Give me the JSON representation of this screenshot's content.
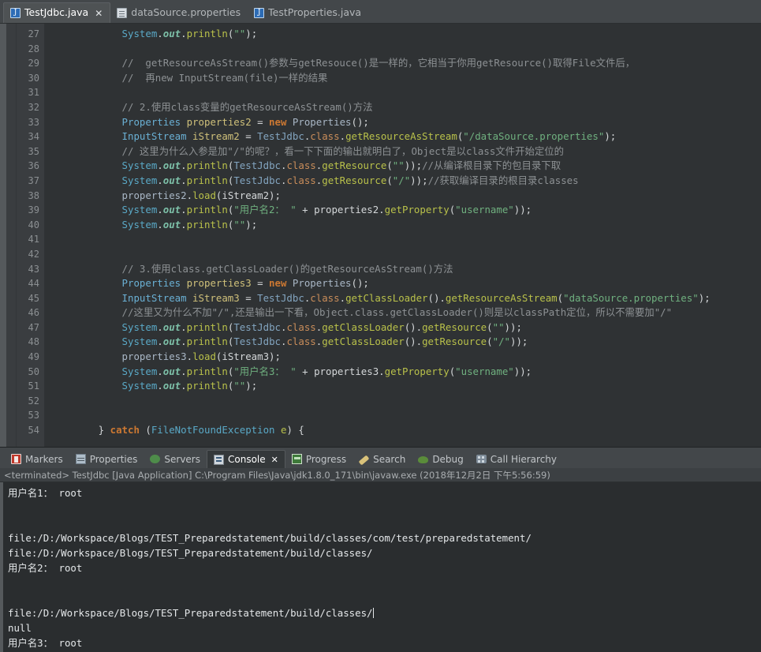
{
  "editor_tabs": [
    {
      "label": "TestJdbc.java",
      "icon": "java-file-icon",
      "active": true,
      "close": "✕"
    },
    {
      "label": "dataSource.properties",
      "icon": "properties-file-icon",
      "active": false,
      "close": ""
    },
    {
      "label": "TestProperties.java",
      "icon": "java-file-icon",
      "active": false,
      "close": ""
    }
  ],
  "gutter": {
    "first_line": 27,
    "numbers": [
      27,
      28,
      29,
      30,
      31,
      32,
      33,
      34,
      35,
      36,
      37,
      38,
      39,
      40,
      41,
      42,
      43,
      44,
      45,
      46,
      47,
      48,
      49,
      50,
      51,
      52,
      53,
      54
    ]
  },
  "code_lines": [
    {
      "n": 27,
      "segments": [
        {
          "t": "            ",
          "c": "pln"
        },
        {
          "t": "System",
          "c": "sys"
        },
        {
          "t": ".",
          "c": "pln"
        },
        {
          "t": "out",
          "c": "out"
        },
        {
          "t": ".",
          "c": "pln"
        },
        {
          "t": "println",
          "c": "mth"
        },
        {
          "t": "(",
          "c": "pln"
        },
        {
          "t": "\"\"",
          "c": "str"
        },
        {
          "t": ");",
          "c": "pln"
        }
      ]
    },
    {
      "n": 28,
      "segments": [
        {
          "t": "",
          "c": "pln"
        }
      ]
    },
    {
      "n": 29,
      "segments": [
        {
          "t": "            ",
          "c": "pln"
        },
        {
          "t": "//  getResourceAsStream()参数与getResouce()是一样的，它相当于你用getResource()取得File文件后，",
          "c": "cmt"
        }
      ]
    },
    {
      "n": 30,
      "segments": [
        {
          "t": "            ",
          "c": "pln"
        },
        {
          "t": "//  再new InputStream(file)一样的结果",
          "c": "cmt"
        }
      ]
    },
    {
      "n": 31,
      "segments": [
        {
          "t": "",
          "c": "pln"
        }
      ]
    },
    {
      "n": 32,
      "segments": [
        {
          "t": "            ",
          "c": "pln"
        },
        {
          "t": "// 2.使用class变量的getResourceAsStream()方法",
          "c": "cmt"
        }
      ]
    },
    {
      "n": 33,
      "segments": [
        {
          "t": "            ",
          "c": "pln"
        },
        {
          "t": "Properties",
          "c": "type"
        },
        {
          "t": " properties2 ",
          "c": "var"
        },
        {
          "t": "= ",
          "c": "pln"
        },
        {
          "t": "new",
          "c": "kw"
        },
        {
          "t": " ",
          "c": "pln"
        },
        {
          "t": "Properties",
          "c": "pvar"
        },
        {
          "t": "();",
          "c": "pln"
        }
      ]
    },
    {
      "n": 34,
      "segments": [
        {
          "t": "            ",
          "c": "pln"
        },
        {
          "t": "InputStream",
          "c": "type"
        },
        {
          "t": " iStream2 ",
          "c": "var"
        },
        {
          "t": "= ",
          "c": "pln"
        },
        {
          "t": "TestJdbc",
          "c": "cls"
        },
        {
          "t": ".",
          "c": "pln"
        },
        {
          "t": "class",
          "c": "cfld"
        },
        {
          "t": ".",
          "c": "pln"
        },
        {
          "t": "getResourceAsStream",
          "c": "mth"
        },
        {
          "t": "(",
          "c": "pln"
        },
        {
          "t": "\"/dataSource.properties\"",
          "c": "str"
        },
        {
          "t": ");",
          "c": "pln"
        }
      ]
    },
    {
      "n": 35,
      "segments": [
        {
          "t": "            ",
          "c": "pln"
        },
        {
          "t": "// 这里为什么入参是加\"/\"的呢？，看一下下面的输出就明白了，Object是以class文件开始定位的",
          "c": "cmt"
        }
      ]
    },
    {
      "n": 36,
      "segments": [
        {
          "t": "            ",
          "c": "pln"
        },
        {
          "t": "System",
          "c": "sys"
        },
        {
          "t": ".",
          "c": "pln"
        },
        {
          "t": "out",
          "c": "out"
        },
        {
          "t": ".",
          "c": "pln"
        },
        {
          "t": "println",
          "c": "mth"
        },
        {
          "t": "(",
          "c": "pln"
        },
        {
          "t": "TestJdbc",
          "c": "cls"
        },
        {
          "t": ".",
          "c": "pln"
        },
        {
          "t": "class",
          "c": "cfld"
        },
        {
          "t": ".",
          "c": "pln"
        },
        {
          "t": "getResource",
          "c": "mth"
        },
        {
          "t": "(",
          "c": "pln"
        },
        {
          "t": "\"\"",
          "c": "str"
        },
        {
          "t": "));",
          "c": "pln"
        },
        {
          "t": "//从编译根目录下的包目录下取",
          "c": "cmt"
        }
      ]
    },
    {
      "n": 37,
      "segments": [
        {
          "t": "            ",
          "c": "pln"
        },
        {
          "t": "System",
          "c": "sys"
        },
        {
          "t": ".",
          "c": "pln"
        },
        {
          "t": "out",
          "c": "out"
        },
        {
          "t": ".",
          "c": "pln"
        },
        {
          "t": "println",
          "c": "mth"
        },
        {
          "t": "(",
          "c": "pln"
        },
        {
          "t": "TestJdbc",
          "c": "cls"
        },
        {
          "t": ".",
          "c": "pln"
        },
        {
          "t": "class",
          "c": "cfld"
        },
        {
          "t": ".",
          "c": "pln"
        },
        {
          "t": "getResource",
          "c": "mth"
        },
        {
          "t": "(",
          "c": "pln"
        },
        {
          "t": "\"/\"",
          "c": "str"
        },
        {
          "t": "));",
          "c": "pln"
        },
        {
          "t": "//获取编译目录的根目录classes",
          "c": "cmt"
        }
      ]
    },
    {
      "n": 38,
      "segments": [
        {
          "t": "            ",
          "c": "pln"
        },
        {
          "t": "properties2",
          "c": "pvar"
        },
        {
          "t": ".",
          "c": "pln"
        },
        {
          "t": "load",
          "c": "mth"
        },
        {
          "t": "(iStream2);",
          "c": "pln"
        }
      ]
    },
    {
      "n": 39,
      "segments": [
        {
          "t": "            ",
          "c": "pln"
        },
        {
          "t": "System",
          "c": "sys"
        },
        {
          "t": ".",
          "c": "pln"
        },
        {
          "t": "out",
          "c": "out"
        },
        {
          "t": ".",
          "c": "pln"
        },
        {
          "t": "println",
          "c": "mth"
        },
        {
          "t": "(",
          "c": "pln"
        },
        {
          "t": "\"用户名2： \"",
          "c": "str"
        },
        {
          "t": " + properties2.",
          "c": "pln"
        },
        {
          "t": "getProperty",
          "c": "mth"
        },
        {
          "t": "(",
          "c": "pln"
        },
        {
          "t": "\"username\"",
          "c": "str"
        },
        {
          "t": "));",
          "c": "pln"
        }
      ]
    },
    {
      "n": 40,
      "segments": [
        {
          "t": "            ",
          "c": "pln"
        },
        {
          "t": "System",
          "c": "sys"
        },
        {
          "t": ".",
          "c": "pln"
        },
        {
          "t": "out",
          "c": "out"
        },
        {
          "t": ".",
          "c": "pln"
        },
        {
          "t": "println",
          "c": "mth"
        },
        {
          "t": "(",
          "c": "pln"
        },
        {
          "t": "\"\"",
          "c": "str"
        },
        {
          "t": ");",
          "c": "pln"
        }
      ]
    },
    {
      "n": 41,
      "segments": [
        {
          "t": "",
          "c": "pln"
        }
      ]
    },
    {
      "n": 42,
      "segments": [
        {
          "t": "",
          "c": "pln"
        }
      ]
    },
    {
      "n": 43,
      "segments": [
        {
          "t": "            ",
          "c": "pln"
        },
        {
          "t": "// 3.使用class.getClassLoader()的getResourceAsStream()方法",
          "c": "cmt"
        }
      ]
    },
    {
      "n": 44,
      "segments": [
        {
          "t": "            ",
          "c": "pln"
        },
        {
          "t": "Properties",
          "c": "type"
        },
        {
          "t": " properties3 ",
          "c": "var"
        },
        {
          "t": "= ",
          "c": "pln"
        },
        {
          "t": "new",
          "c": "kw"
        },
        {
          "t": " ",
          "c": "pln"
        },
        {
          "t": "Properties",
          "c": "pvar"
        },
        {
          "t": "();",
          "c": "pln"
        }
      ]
    },
    {
      "n": 45,
      "segments": [
        {
          "t": "            ",
          "c": "pln"
        },
        {
          "t": "InputStream",
          "c": "type"
        },
        {
          "t": " iStream3 ",
          "c": "var"
        },
        {
          "t": "= ",
          "c": "pln"
        },
        {
          "t": "TestJdbc",
          "c": "cls"
        },
        {
          "t": ".",
          "c": "pln"
        },
        {
          "t": "class",
          "c": "cfld"
        },
        {
          "t": ".",
          "c": "pln"
        },
        {
          "t": "getClassLoader",
          "c": "mth"
        },
        {
          "t": "().",
          "c": "pln"
        },
        {
          "t": "getResourceAsStream",
          "c": "mth"
        },
        {
          "t": "(",
          "c": "pln"
        },
        {
          "t": "\"dataSource.properties\"",
          "c": "str"
        },
        {
          "t": ");",
          "c": "pln"
        }
      ]
    },
    {
      "n": 46,
      "segments": [
        {
          "t": "            ",
          "c": "pln"
        },
        {
          "t": "//这里又为什么不加\"/\",还是输出一下看，Object.class.getClassLoader()则是以classPath定位，所以不需要加\"/\"",
          "c": "cmt"
        }
      ]
    },
    {
      "n": 47,
      "segments": [
        {
          "t": "            ",
          "c": "pln"
        },
        {
          "t": "System",
          "c": "sys"
        },
        {
          "t": ".",
          "c": "pln"
        },
        {
          "t": "out",
          "c": "out"
        },
        {
          "t": ".",
          "c": "pln"
        },
        {
          "t": "println",
          "c": "mth"
        },
        {
          "t": "(",
          "c": "pln"
        },
        {
          "t": "TestJdbc",
          "c": "cls"
        },
        {
          "t": ".",
          "c": "pln"
        },
        {
          "t": "class",
          "c": "cfld"
        },
        {
          "t": ".",
          "c": "pln"
        },
        {
          "t": "getClassLoader",
          "c": "mth"
        },
        {
          "t": "().",
          "c": "pln"
        },
        {
          "t": "getResource",
          "c": "mth"
        },
        {
          "t": "(",
          "c": "pln"
        },
        {
          "t": "\"\"",
          "c": "str"
        },
        {
          "t": "));",
          "c": "pln"
        }
      ]
    },
    {
      "n": 48,
      "segments": [
        {
          "t": "            ",
          "c": "pln"
        },
        {
          "t": "System",
          "c": "sys"
        },
        {
          "t": ".",
          "c": "pln"
        },
        {
          "t": "out",
          "c": "out"
        },
        {
          "t": ".",
          "c": "pln"
        },
        {
          "t": "println",
          "c": "mth"
        },
        {
          "t": "(",
          "c": "pln"
        },
        {
          "t": "TestJdbc",
          "c": "cls"
        },
        {
          "t": ".",
          "c": "pln"
        },
        {
          "t": "class",
          "c": "cfld"
        },
        {
          "t": ".",
          "c": "pln"
        },
        {
          "t": "getClassLoader",
          "c": "mth"
        },
        {
          "t": "().",
          "c": "pln"
        },
        {
          "t": "getResource",
          "c": "mth"
        },
        {
          "t": "(",
          "c": "pln"
        },
        {
          "t": "\"/\"",
          "c": "str"
        },
        {
          "t": "));",
          "c": "pln"
        }
      ]
    },
    {
      "n": 49,
      "segments": [
        {
          "t": "            ",
          "c": "pln"
        },
        {
          "t": "properties3",
          "c": "pvar"
        },
        {
          "t": ".",
          "c": "pln"
        },
        {
          "t": "load",
          "c": "mth"
        },
        {
          "t": "(iStream3);",
          "c": "pln"
        }
      ]
    },
    {
      "n": 50,
      "segments": [
        {
          "t": "            ",
          "c": "pln"
        },
        {
          "t": "System",
          "c": "sys"
        },
        {
          "t": ".",
          "c": "pln"
        },
        {
          "t": "out",
          "c": "out"
        },
        {
          "t": ".",
          "c": "pln"
        },
        {
          "t": "println",
          "c": "mth"
        },
        {
          "t": "(",
          "c": "pln"
        },
        {
          "t": "\"用户名3： \"",
          "c": "str"
        },
        {
          "t": " + properties3.",
          "c": "pln"
        },
        {
          "t": "getProperty",
          "c": "mth"
        },
        {
          "t": "(",
          "c": "pln"
        },
        {
          "t": "\"username\"",
          "c": "str"
        },
        {
          "t": "));",
          "c": "pln"
        }
      ]
    },
    {
      "n": 51,
      "segments": [
        {
          "t": "            ",
          "c": "pln"
        },
        {
          "t": "System",
          "c": "sys"
        },
        {
          "t": ".",
          "c": "pln"
        },
        {
          "t": "out",
          "c": "out"
        },
        {
          "t": ".",
          "c": "pln"
        },
        {
          "t": "println",
          "c": "mth"
        },
        {
          "t": "(",
          "c": "pln"
        },
        {
          "t": "\"\"",
          "c": "str"
        },
        {
          "t": ");",
          "c": "pln"
        }
      ]
    },
    {
      "n": 52,
      "segments": [
        {
          "t": "",
          "c": "pln"
        }
      ]
    },
    {
      "n": 53,
      "segments": [
        {
          "t": "",
          "c": "pln"
        }
      ]
    },
    {
      "n": 54,
      "segments": [
        {
          "t": "        } ",
          "c": "pln"
        },
        {
          "t": "catch",
          "c": "kw"
        },
        {
          "t": " (",
          "c": "pln"
        },
        {
          "t": "FileNotFoundException",
          "c": "exc"
        },
        {
          "t": " ",
          "c": "pln"
        },
        {
          "t": "e",
          "c": "mth"
        },
        {
          "t": ") {",
          "c": "pln"
        }
      ]
    }
  ],
  "view_tabs": [
    {
      "label": "Markers",
      "icon": "markers-icon",
      "active": false
    },
    {
      "label": "Properties",
      "icon": "properties-icon",
      "active": false
    },
    {
      "label": "Servers",
      "icon": "servers-icon",
      "active": false
    },
    {
      "label": "Console",
      "icon": "console-icon",
      "active": true,
      "close": "✕"
    },
    {
      "label": "Progress",
      "icon": "progress-icon",
      "active": false
    },
    {
      "label": "Search",
      "icon": "search-icon",
      "active": false
    },
    {
      "label": "Debug",
      "icon": "debug-icon",
      "active": false
    },
    {
      "label": "Call Hierarchy",
      "icon": "call-hierarchy-icon",
      "active": false
    }
  ],
  "console": {
    "status_line": "<terminated> TestJdbc [Java Application] C:\\Program Files\\Java\\jdk1.8.0_171\\bin\\javaw.exe (2018年12月2日 下午5:56:59)",
    "output_lines": [
      "用户名1： root",
      "",
      "",
      "file:/D:/Workspace/Blogs/TEST_Preparedstatement/build/classes/com/test/preparedstatement/",
      "file:/D:/Workspace/Blogs/TEST_Preparedstatement/build/classes/",
      "用户名2： root",
      "",
      "",
      "file:/D:/Workspace/Blogs/TEST_Preparedstatement/build/classes/",
      "null",
      "用户名3： root"
    ],
    "caret_line_index": 8
  },
  "colors": {
    "editor_bg": "#2f3234",
    "gutter_bg": "#3a3d40",
    "tabbar_bg": "#43474a",
    "active_tab_bg": "#4e5254",
    "console_bg": "#2a2d2f",
    "panel_bg": "#3c4043",
    "accent_strip": "#55595c",
    "comment": "#8d9194",
    "string": "#6fb07f",
    "keyword": "#cc7832",
    "method": "#b9c14a",
    "type": "#6ab0d4"
  }
}
